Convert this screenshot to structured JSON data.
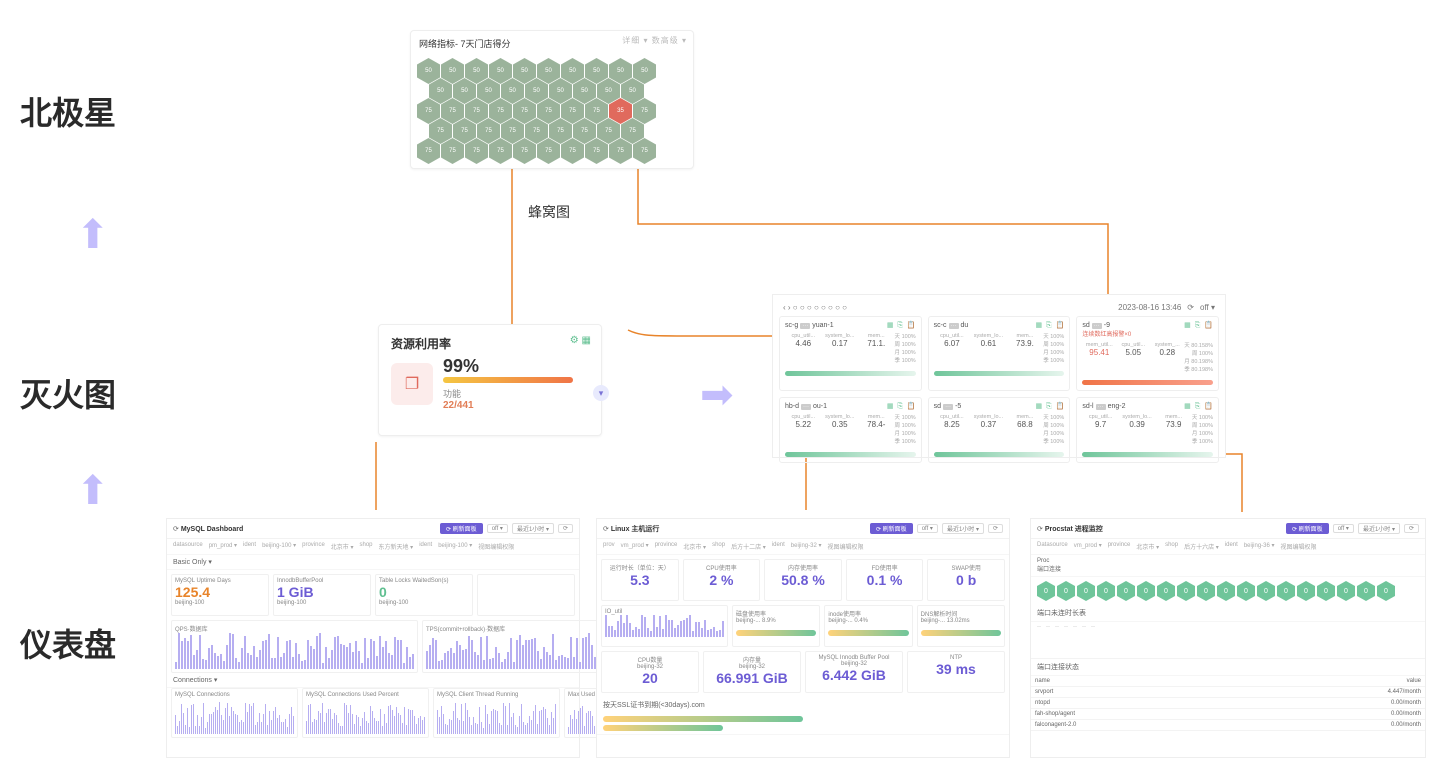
{
  "levels": {
    "l1": "北极星",
    "l2": "灭火图",
    "l3": "仪表盘"
  },
  "honeycomb": {
    "title": "网络指标- 7天门店得分",
    "filter": "详细 ▾   数高级 ▾",
    "caption": "蜂窝图",
    "rows": [
      [
        50,
        50,
        50,
        50,
        50,
        50,
        50,
        50,
        50,
        50
      ],
      [
        50,
        50,
        50,
        50,
        50,
        50,
        50,
        50,
        50
      ],
      [
        75,
        75,
        75,
        75,
        75,
        75,
        75,
        75,
        {
          "v": 35,
          "bad": true
        },
        75
      ],
      [
        75,
        75,
        75,
        75,
        75,
        75,
        75,
        75,
        75
      ],
      [
        75,
        75,
        75,
        75,
        75,
        75,
        75,
        75,
        75,
        75
      ]
    ]
  },
  "fire": {
    "title": "资源利用率",
    "pct": "99%",
    "sub": "功能",
    "frac": "22/441"
  },
  "serverPanel": {
    "date": "2023-08-16 13:46",
    "mode": "off ▾",
    "servers": [
      {
        "name": "sc-g·····yuan-1",
        "m": [
          [
            "cpu_util...",
            "4.46"
          ],
          [
            "system_lo...",
            "0.17"
          ],
          [
            "mem...",
            "71.1."
          ]
        ],
        "p": [
          "天 100%",
          "周 100%",
          "月 100%",
          "季 100%"
        ]
      },
      {
        "name": "sc-c·····du",
        "m": [
          [
            "cpu_util...",
            "6.07"
          ],
          [
            "system_lo...",
            "0.61"
          ],
          [
            "mem...",
            "73.9."
          ]
        ],
        "p": [
          "天 100%",
          "周 100%",
          "月 100%",
          "季 100%"
        ]
      },
      {
        "name": "sd·····-9",
        "alert": "连续数红高报警×0",
        "bad": true,
        "m": [
          [
            "mem_util...",
            "95.41"
          ],
          [
            "cpu_util...",
            "5.05"
          ],
          [
            "system_...",
            "0.28"
          ]
        ],
        "p": [
          "天 80.158%",
          "周 100%",
          "月 80.198%",
          "季 80.198%"
        ]
      },
      {
        "name": "hb-d·····ou-1",
        "m": [
          [
            "cpu_util...",
            "5.22"
          ],
          [
            "system_lo...",
            "0.35"
          ],
          [
            "mem...",
            "78.4-"
          ]
        ],
        "p": [
          "天 100%",
          "周 100%",
          "月 100%",
          "季 100%"
        ]
      },
      {
        "name": "sd·····-5",
        "m": [
          [
            "cpu_util...",
            "8.25"
          ],
          [
            "system_lo...",
            "0.37"
          ],
          [
            "mem...",
            "68.8"
          ]
        ],
        "p": [
          "天 100%",
          "周 100%",
          "月 100%",
          "季 100%"
        ]
      },
      {
        "name": "sd-l·····eng-2",
        "m": [
          [
            "cpu_util...",
            "9.7"
          ],
          [
            "system_lo...",
            "0.39"
          ],
          [
            "mem...",
            "73.9"
          ]
        ],
        "p": [
          "天 100%",
          "周 100%",
          "月 100%",
          "季 100%"
        ]
      }
    ]
  },
  "dash1": {
    "title": "MySQL Dashboard",
    "off": "off ▾",
    "saveBtn": "⟳ 刷新面板",
    "filters": [
      "datasource",
      "pm_prod ▾",
      "ident",
      "beijing-100 ▾",
      "province",
      "北京市 ▾",
      "shop",
      "东方新天地 ▾",
      "ident",
      "beijing-100 ▾",
      "视图编辑权限"
    ],
    "sect": "Basic Only ▾",
    "tiles": [
      {
        "t": "MySQL Uptime Days",
        "v": "125.4",
        "sub": "beijing-100"
      },
      {
        "t": "InnodbBufferPool",
        "v": "1 GiB",
        "sub": "beijing-100"
      },
      {
        "t": "Table Locks WaitedSon(s)",
        "v": "0",
        "sub": "beijing-100"
      },
      {
        "t": ""
      }
    ],
    "charts": [
      "QPS·数据库",
      "TPS(commit+rollback)·数据库"
    ],
    "sect2": "Connections ▾",
    "charts2": [
      "MySQL Connections",
      "MySQL Connections Used Percent",
      "MySQL Client Thread Running",
      "Max Used and Aborted Connections"
    ]
  },
  "dash2": {
    "title": "Linux 主机运行",
    "off": "off ▾",
    "saveBtn": "⟳ 刷新面板",
    "filters": [
      "prov",
      "vm_prod ▾",
      "province",
      "北京市 ▾",
      "shop",
      "后方十二店 ▾",
      "ident",
      "beijing-32 ▾",
      "视图编辑权限"
    ],
    "metrics": [
      {
        "t": "运行时长（单位：天）",
        "v": "5.3"
      },
      {
        "t": "CPU使用率",
        "v": "2 %"
      },
      {
        "t": "内存使用率",
        "v": "50.8 %"
      },
      {
        "t": "FD使用率",
        "v": "0.1 %"
      },
      {
        "t": "SWAP使用",
        "v": "0 b"
      }
    ],
    "row2": [
      {
        "t": "IO_util",
        "chart": true
      },
      {
        "t": "磁盘使用率",
        "sub": "beijing-... 8.9%"
      },
      {
        "t": "inode使用率",
        "sub": "beijing-... 0.4%"
      },
      {
        "t": "DNS解析时间",
        "sub": "beijing-... 13.02ms"
      }
    ],
    "row3": [
      {
        "t": "CPU数量",
        "host": "beijing-32",
        "v": "20"
      },
      {
        "t": "内存量",
        "host": "beijing-32",
        "v": "66.991 GiB"
      },
      {
        "t": "MySQL Innodb Buffer Pool",
        "host": "beijing-32",
        "v": "6.442 GiB"
      },
      {
        "t": "NTP",
        "v": "39 ms"
      }
    ],
    "bottom": "按天SSL证书到期(<30days).com"
  },
  "dash3": {
    "title": "Procstat 进程监控",
    "off": "off ▾",
    "saveBtn": "⟳ 刷新面板",
    "filters": [
      "Datasource",
      "vm_prod ▾",
      "province",
      "北京市 ▾",
      "shop",
      "后方十六店 ▾",
      "ident",
      "beijing-36 ▾",
      "视图编辑权限"
    ],
    "sect": "端口连接",
    "hexval": "0",
    "sect2": "端口未连时长表",
    "sect3": "端口连接状态",
    "table": [
      [
        "name",
        "value"
      ],
      [
        "srvport",
        "4.447/month"
      ],
      [
        "ntopd",
        "0.00/month"
      ],
      [
        "fah-shop/agent",
        "0.00/month"
      ],
      [
        "falconagent-2.0",
        "0.00/month"
      ]
    ]
  }
}
